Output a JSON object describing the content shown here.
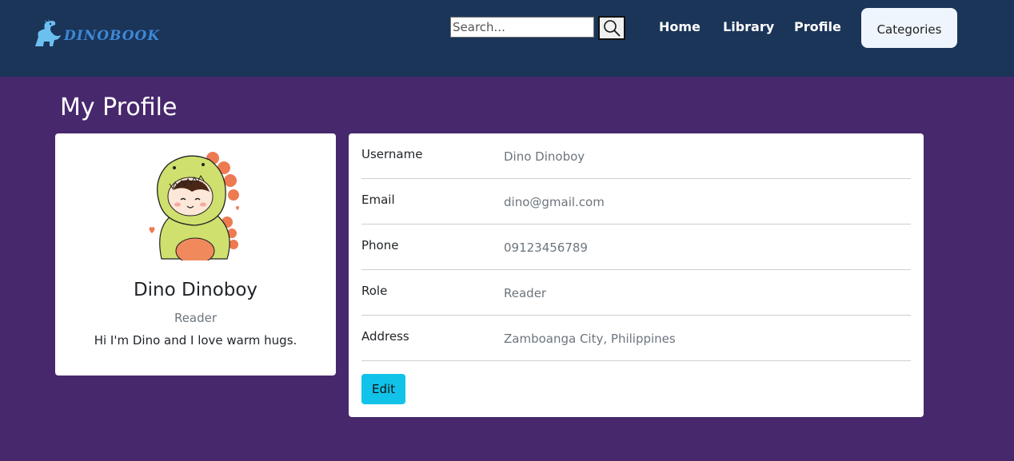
{
  "brand": {
    "name": "DINOBOOK"
  },
  "search": {
    "placeholder": "Search..."
  },
  "nav": {
    "home": "Home",
    "library": "Library",
    "profile": "Profile",
    "categories": "Categories"
  },
  "page": {
    "title": "My Profile"
  },
  "profile_card": {
    "name": "Dino Dinoboy",
    "role": "Reader",
    "bio": "Hi I'm Dino and I love warm hugs."
  },
  "details": [
    {
      "label": "Username",
      "value": "Dino Dinoboy"
    },
    {
      "label": "Email",
      "value": "dino@gmail.com"
    },
    {
      "label": "Phone",
      "value": "09123456789"
    },
    {
      "label": "Role",
      "value": "Reader"
    },
    {
      "label": "Address",
      "value": "Zamboanga City, Philippines"
    }
  ],
  "actions": {
    "edit": "Edit"
  },
  "colors": {
    "navbar": "#1b3559",
    "background": "#48286d",
    "edit_button": "#11c3e8",
    "categories_button": "#eef5fc"
  },
  "icons": {
    "logo": "dinosaur-logo-icon",
    "search": "magnifier-icon",
    "avatar": "dinosaur-costume-kid-avatar"
  }
}
